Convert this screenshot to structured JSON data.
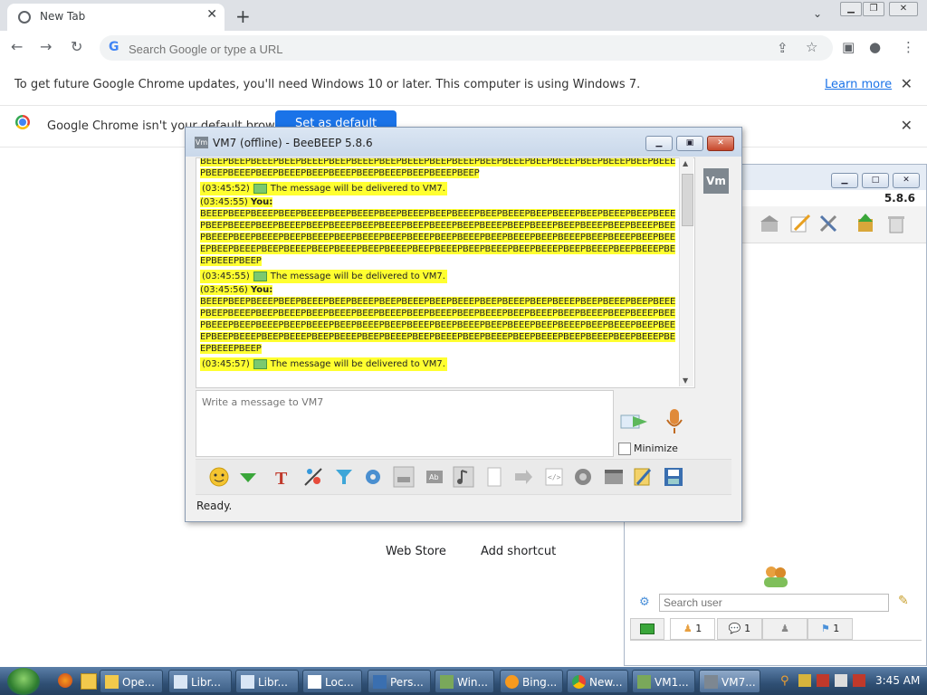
{
  "chrome": {
    "tab_title": "New Tab",
    "omnibox_placeholder": "Search Google or type a URL",
    "update_notice": "To get future Google Chrome updates, you'll need Windows 10 or later. This computer is using Windows 7.",
    "learn_more": "Learn more",
    "default_notice": "Google Chrome isn't your default browser",
    "set_default": "Set as default",
    "ntp_links": [
      "Web Store",
      "Add shortcut"
    ]
  },
  "beebeep_main": {
    "version": "5.8.6",
    "search_placeholder": "Search user",
    "tab_counts": [
      "1",
      "1",
      "1"
    ]
  },
  "chat": {
    "title": "VM7 (offline) - BeeBEEP 5.8.6",
    "avatar": "Vm",
    "lines": [
      {
        "kind": "bee",
        "text": "BEEEPBEEPBEEEPBEEPBEEEPBEEPBEEEPBEEPBEEEPBEEPBEEEPBEEPBEEEPBEEPBEEEPBEEPBEEEPBEEPBEEEPBEEPBEEEPBEEPBEEEPBEEPBEEEPBEEPBEEEPBEEPBEEEPBEEP"
      },
      {
        "kind": "sys",
        "time": "(03:45:52)",
        "text": "The message will be delivered to VM7."
      },
      {
        "kind": "you",
        "time": "(03:45:55)",
        "label": "You:"
      },
      {
        "kind": "bee",
        "text": "BEEEPBEEPBEEEPBEEPBEEEPBEEPBEEEPBEEPBEEEPBEEPBEEEPBEEPBEEEPBEEPBEEEPBEEPBEEEPBEEPBEEEPBEEPBEEEPBEEPBEEEPBEEPBEEEPBEEPBEEEPBEEPBEEEPBEEPBEEEPBEEPBEEEPBEEPBEEEPBEEPBEEEPBEEPBEEEPBEEPBEEEPBEEPBEEEPBEEPBEEEPBEEPBEEEPBEEPBEEEPBEEPBEEEPBEEPBEEEPBEEPBEEEPBEEPBEEEPBEEPBEEEPBEEPBEEEPBEEPBEEEPBEEPBEEEPBEEPBEEEPBEEPBEEEPBEEPBEEEPBEEPBEEEPBEEPBEEEPBEEPBEEEPBEEP"
      },
      {
        "kind": "sys",
        "time": "(03:45:55)",
        "text": "The message will be delivered to VM7."
      },
      {
        "kind": "you",
        "time": "(03:45:56)",
        "label": "You:"
      },
      {
        "kind": "bee",
        "text": "BEEEPBEEPBEEEPBEEPBEEEPBEEPBEEEPBEEPBEEEPBEEPBEEEPBEEPBEEEPBEEPBEEEPBEEPBEEEPBEEPBEEEPBEEPBEEEPBEEPBEEEPBEEPBEEEPBEEPBEEEPBEEPBEEEPBEEPBEEEPBEEPBEEEPBEEPBEEEPBEEPBEEEPBEEPBEEEPBEEPBEEEPBEEPBEEEPBEEPBEEEPBEEPBEEEPBEEPBEEEPBEEPBEEEPBEEPBEEEPBEEPBEEEPBEEPBEEEPBEEPBEEEPBEEPBEEEPBEEPBEEEPBEEPBEEEPBEEPBEEEPBEEPBEEEPBEEPBEEEPBEEPBEEEPBEEPBEEEPBEEPBEEEPBEEP"
      },
      {
        "kind": "sys",
        "time": "(03:45:57)",
        "text": "The message will be delivered to VM7."
      }
    ],
    "compose_placeholder": "Write a message to VM7",
    "minimize_label": "Minimize",
    "status": "Ready."
  },
  "taskbar": {
    "tasks": [
      "Ope...",
      "Libr...",
      "Libr...",
      "Loc...",
      "Pers...",
      "Win...",
      "Bing...",
      "New...",
      "VM1...",
      "VM7..."
    ],
    "clock": "3:45 AM"
  }
}
